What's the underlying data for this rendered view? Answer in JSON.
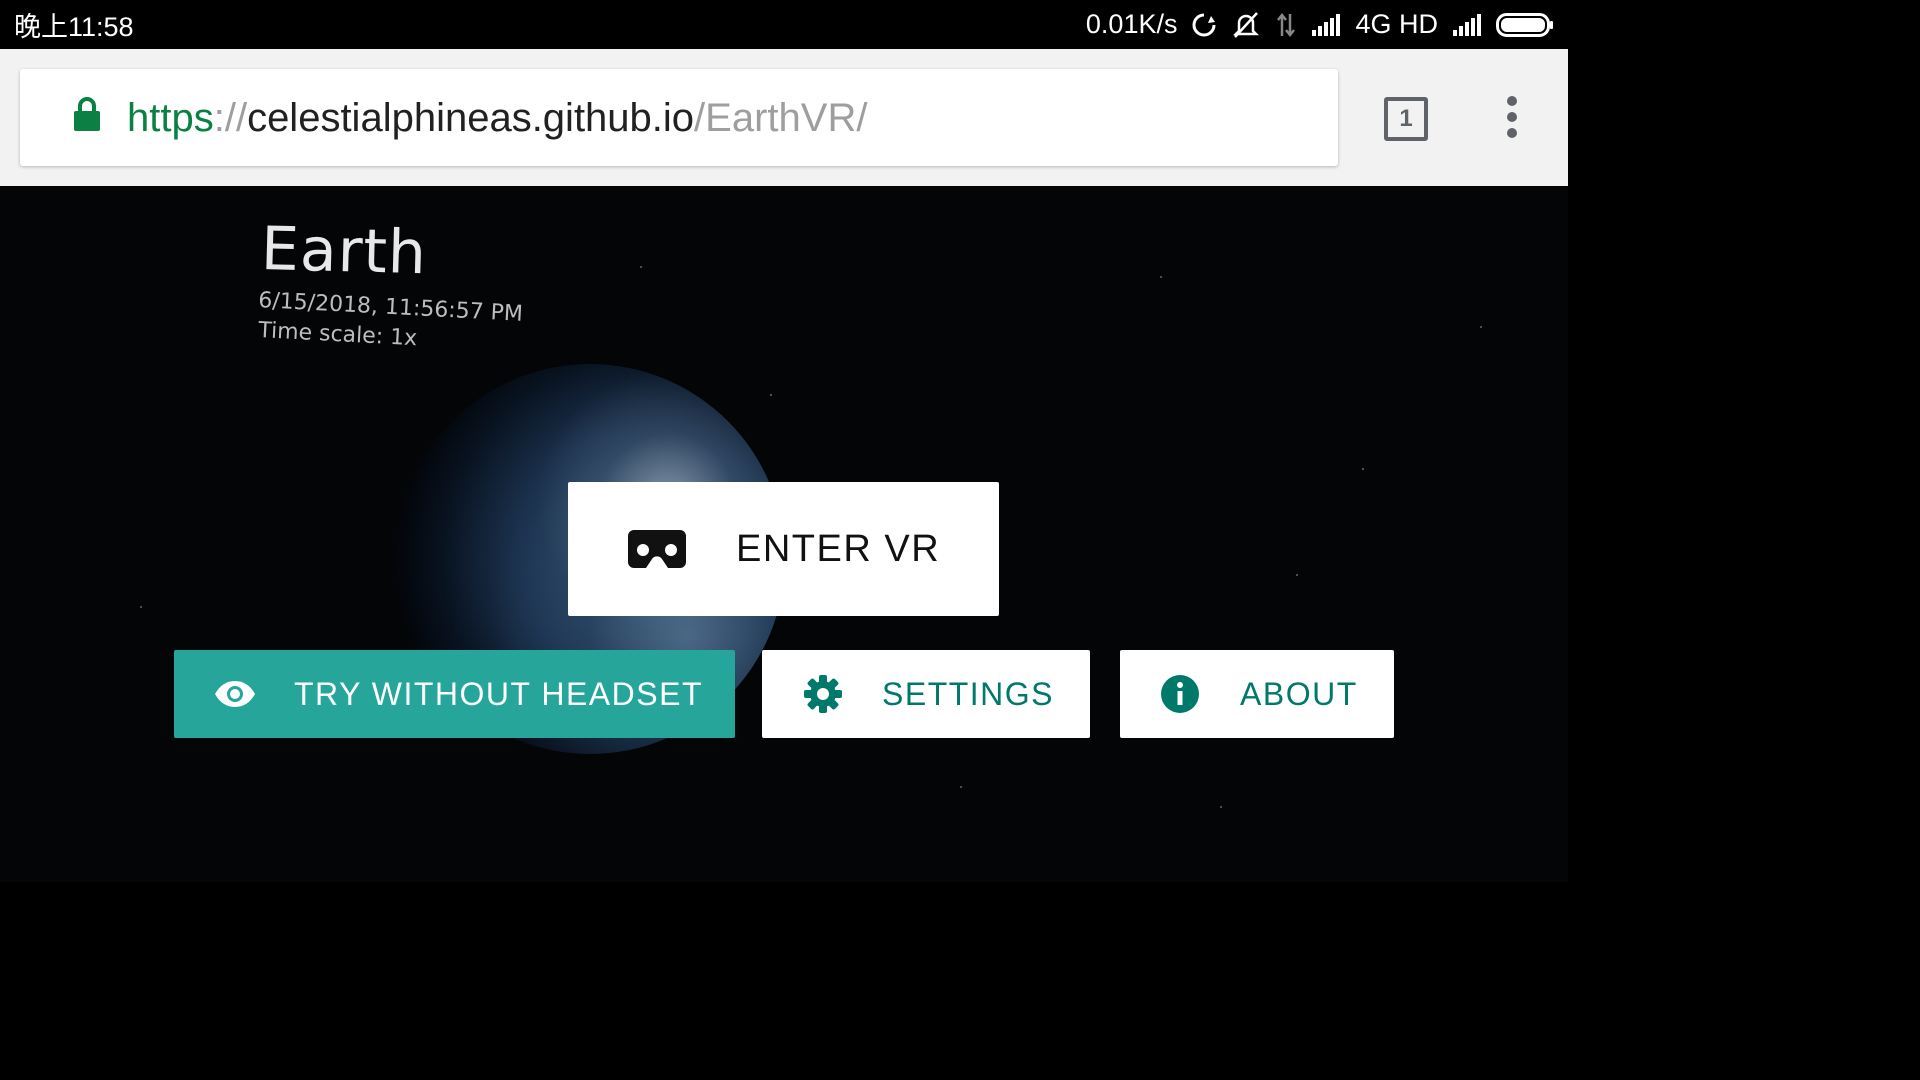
{
  "status_bar": {
    "time": "晚上11:58",
    "net_speed": "0.01K/s",
    "network": "4G HD"
  },
  "browser": {
    "url": {
      "scheme": "https",
      "separator": "://",
      "host": "celestialphineas.github.io",
      "path": "/EarthVR/"
    },
    "tab_count": "1"
  },
  "hud": {
    "title": "Earth",
    "date": "6/15/2018, 11:56:57 PM",
    "time_scale": "Time scale: 1x"
  },
  "buttons": {
    "enter_vr": "ENTER VR",
    "try_without_headset": "TRY WITHOUT HEADSET",
    "settings": "SETTINGS",
    "about": "ABOUT"
  },
  "colors": {
    "accent": "#26a69a",
    "accent_text": "#00796b",
    "url_secure": "#0b8043"
  },
  "icons": {
    "enter_vr": "cardboard-icon",
    "try_without_headset": "eye-icon",
    "settings": "gear-icon",
    "about": "info-icon"
  }
}
